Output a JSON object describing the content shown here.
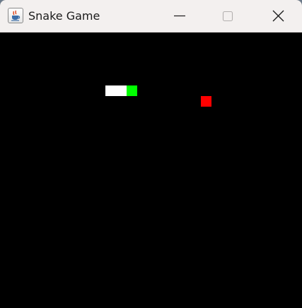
{
  "window": {
    "title": "Snake Game",
    "app_icon": "java-coffee-cup-icon",
    "controls": [
      "minimize-icon",
      "maximize-icon",
      "close-icon"
    ]
  },
  "game": {
    "background_color": "#000000",
    "snake_body_color": "#ffffff",
    "snake_head_color": "#00ff00",
    "food_color": "#ff0000",
    "snake_length": 3
  }
}
